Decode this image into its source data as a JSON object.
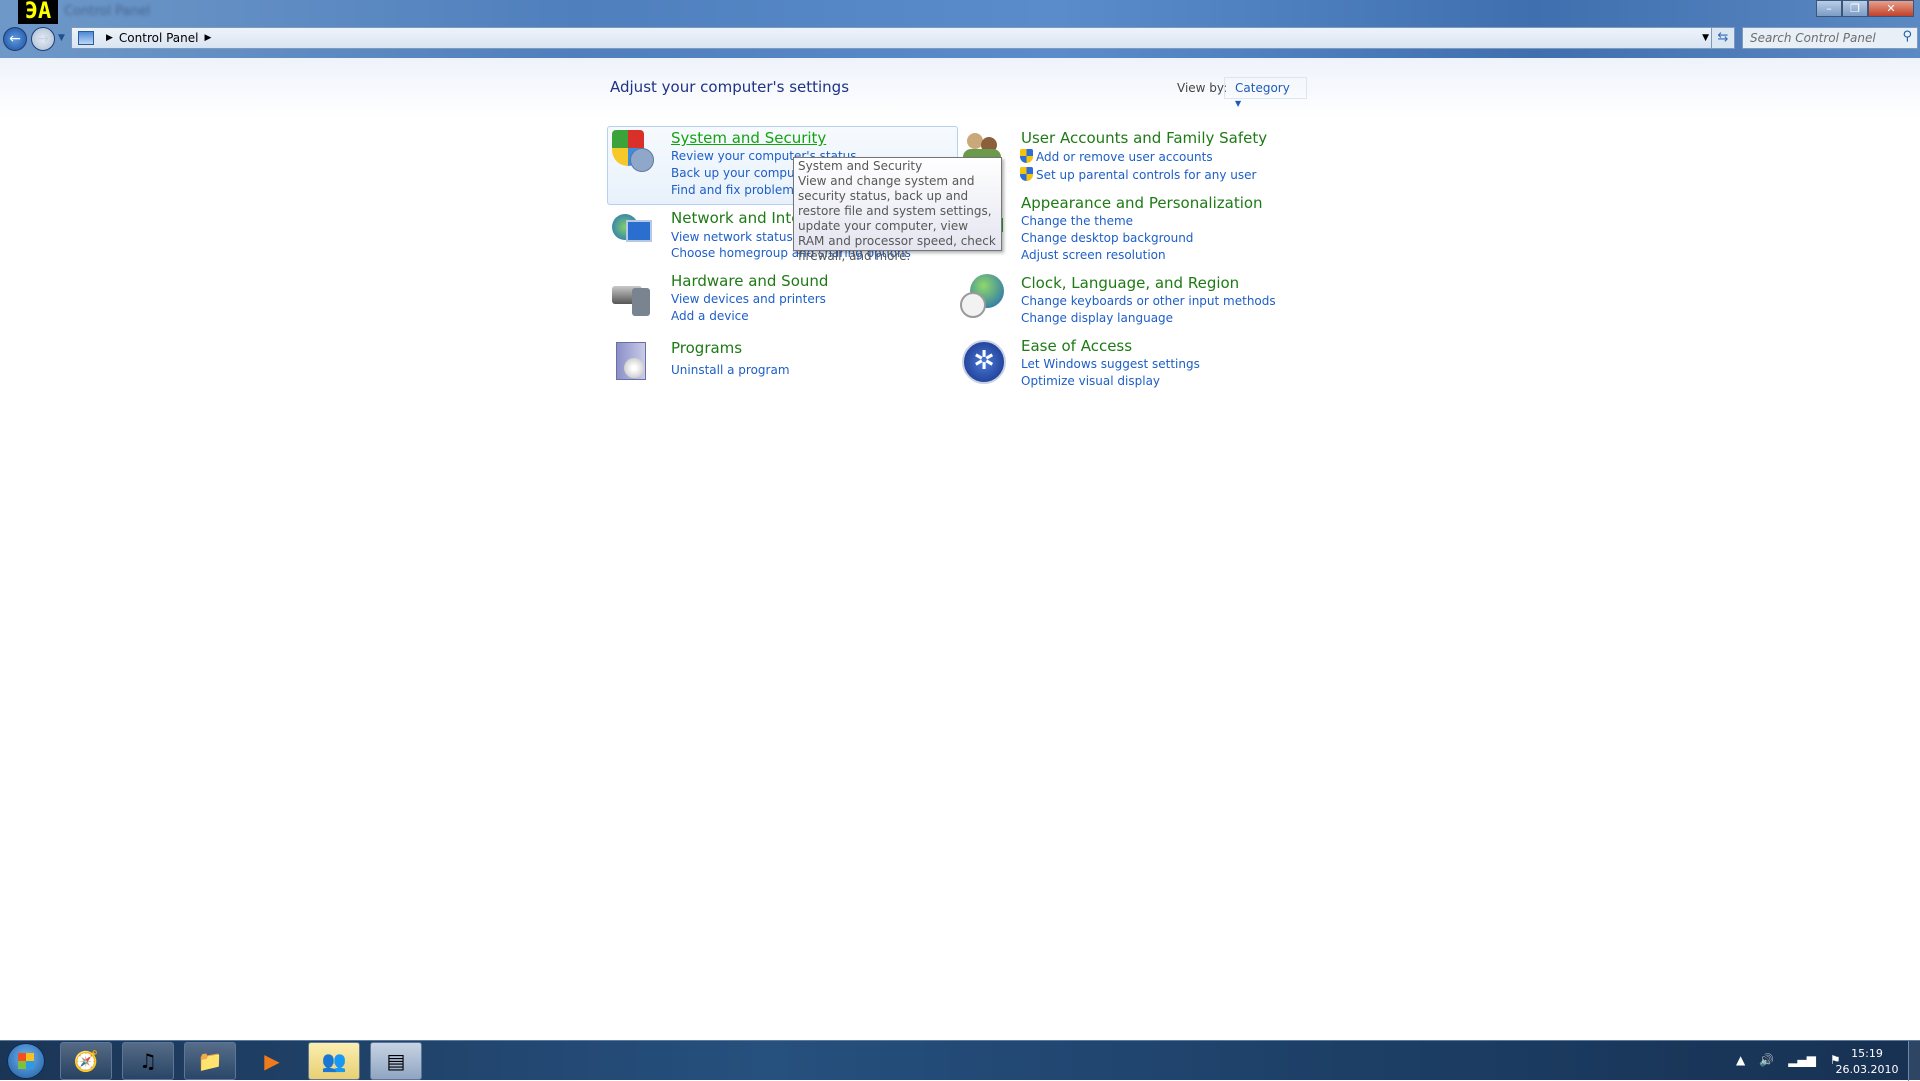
{
  "window": {
    "title": "Control Panel",
    "logo": "ЭА",
    "controls": {
      "minimize": "–",
      "restore": "❐",
      "close": "✕"
    }
  },
  "nav": {
    "back": "←",
    "forward": "→",
    "breadcrumb": [
      "Control Panel"
    ],
    "search_placeholder": "Search Control Panel",
    "refresh": "⇆"
  },
  "main": {
    "heading": "Adjust your computer's settings",
    "view_by_label": "View by:",
    "view_by_value": "Category",
    "categories": [
      {
        "title": "System and Security",
        "links": [
          "Review your computer's status",
          "Back up your computer",
          "Find and fix problems"
        ]
      },
      {
        "title": "Network and Internet",
        "links": [
          "View network status and tasks",
          "Choose homegroup and sharing options"
        ]
      },
      {
        "title": "Hardware and Sound",
        "links": [
          "View devices and printers",
          "Add a device"
        ]
      },
      {
        "title": "Programs",
        "links": [
          "Uninstall a program"
        ]
      },
      {
        "title": "User Accounts and Family Safety",
        "links": [
          "Add or remove user accounts",
          "Set up parental controls for any user"
        ]
      },
      {
        "title": "Appearance and Personalization",
        "links": [
          "Change the theme",
          "Change desktop background",
          "Adjust screen resolution"
        ]
      },
      {
        "title": "Clock, Language, and Region",
        "links": [
          "Change keyboards or other input methods",
          "Change display language"
        ]
      },
      {
        "title": "Ease of Access",
        "links": [
          "Let Windows suggest settings",
          "Optimize visual display"
        ]
      }
    ]
  },
  "tooltip": {
    "title": "System and Security",
    "body": "View and change system and security status, back up and restore file and system settings, update your computer, view RAM and processor speed, check firewall, and more."
  },
  "taskbar": {
    "time": "15:19",
    "date": "26.03.2010"
  }
}
